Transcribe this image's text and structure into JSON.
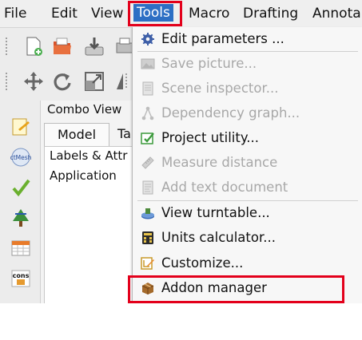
{
  "menubar": {
    "items": [
      {
        "label": "File"
      },
      {
        "label": "Edit"
      },
      {
        "label": "View"
      },
      {
        "label": "Tools"
      },
      {
        "label": "Macro"
      },
      {
        "label": "Drafting"
      },
      {
        "label": "Annota"
      }
    ]
  },
  "combo_view": {
    "title": "Combo View",
    "tabs": [
      {
        "label": "Model"
      },
      {
        "label": "Ta"
      }
    ],
    "tree_header": "Labels & Attr",
    "tree_item": "Application"
  },
  "tools_menu": {
    "items": [
      {
        "label": "Edit parameters ...",
        "enabled": true,
        "icon": "gear-icon"
      },
      {
        "label": "Save picture...",
        "enabled": false,
        "icon": "picture-icon"
      },
      {
        "label": "Scene inspector...",
        "enabled": false,
        "icon": "document-icon"
      },
      {
        "label": "Dependency graph...",
        "enabled": false,
        "icon": "graph-icon"
      },
      {
        "label": "Project utility...",
        "enabled": true,
        "icon": "project-utility-icon"
      },
      {
        "label": "Measure distance",
        "enabled": false,
        "icon": "ruler-icon"
      },
      {
        "label": "Add text document",
        "enabled": false,
        "icon": "text-document-icon"
      },
      {
        "label": "View turntable...",
        "enabled": true,
        "icon": "turntable-icon"
      },
      {
        "label": "Units calculator...",
        "enabled": true,
        "icon": "calculator-icon"
      },
      {
        "label": "Customize...",
        "enabled": true,
        "icon": "customize-icon"
      },
      {
        "label": "Addon manager",
        "enabled": true,
        "icon": "addon-manager-icon"
      }
    ]
  },
  "colors": {
    "highlight": "#e3001b",
    "active_menu": "#2d6fc4",
    "disabled_text": "#a8a8a8"
  }
}
